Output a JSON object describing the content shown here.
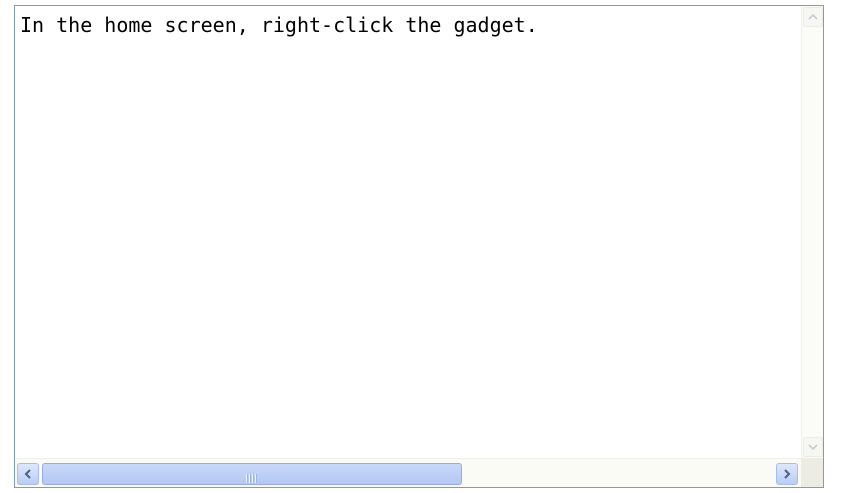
{
  "textarea": {
    "value": "In the home screen, right-click the gadget."
  },
  "scrollbars": {
    "vertical": {
      "up_icon": "chevron-up-icon",
      "down_icon": "chevron-down-icon",
      "enabled": false
    },
    "horizontal": {
      "left_icon": "chevron-left-icon",
      "right_icon": "chevron-right-icon",
      "thumb_fraction": 0.55,
      "thumb_position": 0,
      "enabled": true
    }
  },
  "colors": {
    "border": "#7f9db9",
    "scroll_thumb": "#c1d3fb",
    "arrow": "#4d6185"
  }
}
